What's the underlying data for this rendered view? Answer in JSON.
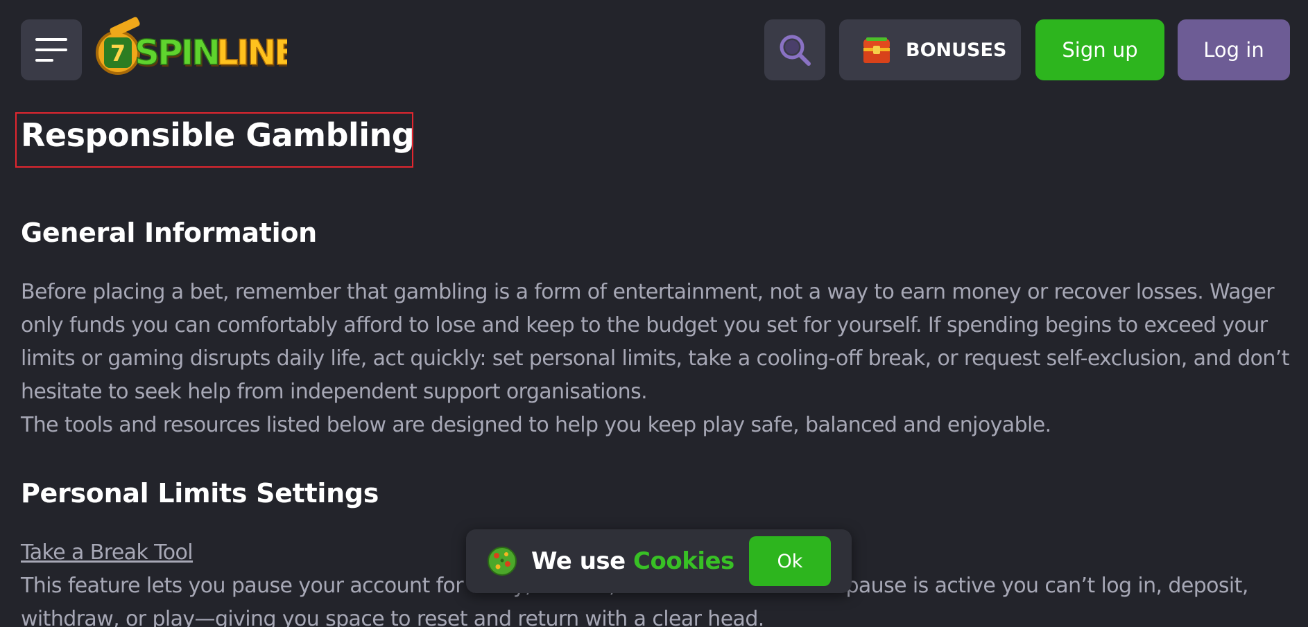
{
  "header": {
    "logo_text": "SPINLINE",
    "bonuses_label": "BONUSES",
    "signup_label": "Sign up",
    "login_label": "Log in"
  },
  "content": {
    "title": "Responsible Gambling",
    "general_heading": "General Information",
    "general_paragraph": "Before placing a bet, remember that gambling is a form of entertainment, not a way to earn money or recover losses. Wager only funds you can comfortably afford to lose and keep to the budget you set for yourself. If spending begins to exceed your limits or gaming disrupts daily life, act quickly: set personal limits, take a cooling-off break, or request self-exclusion, and don’t hesitate to seek help from independent support organisations.",
    "tools_paragraph": "The tools and resources listed below are designed to help you keep play safe, balanced and enjoyable.",
    "limits_heading": "Personal Limits Settings",
    "take_break_link": "Take a Break Tool",
    "take_break_paragraph": "This feature lets you pause your account for a day, a week, or a month. While the pause is active you can’t log in, deposit, withdraw, or play—giving you space to reset and return with a clear head."
  },
  "cookie": {
    "text_prefix": "We use",
    "text_accent": "Cookies",
    "ok_label": "Ok"
  },
  "colors": {
    "background": "#23242b",
    "button_dark": "#3a3b47",
    "signup_green": "#2db51e",
    "login_purple": "#6d5c95",
    "highlight_red": "#e3262f",
    "body_text": "#a7a8b6"
  },
  "icons": {
    "menu": "hamburger-menu-icon",
    "search": "search-icon",
    "bonuses": "treasure-chest-icon",
    "cookie": "cookie-icon"
  }
}
